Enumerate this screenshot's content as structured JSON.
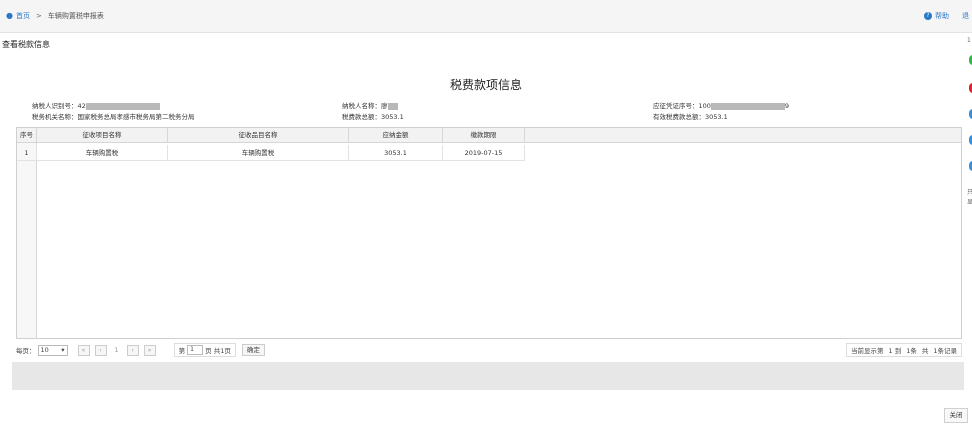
{
  "breadcrumb": {
    "home": "首页",
    "separator": ">",
    "current": "车辆购置税申报表"
  },
  "header": {
    "help_label": "帮助",
    "edge_glyph": "退"
  },
  "right_strip": {
    "chars": [
      "1",
      "只",
      "显"
    ],
    "colors": [
      "#3ab54a",
      "#d9262a",
      "#3b8fd9",
      "#3b8fd9",
      "#3b8fd9"
    ]
  },
  "subheader": "查看税款信息",
  "panel": {
    "title": "税费款项信息",
    "fields": {
      "taxpayer_id_label": "纳税人识别号：",
      "taxpayer_id_visible": "42",
      "taxpayer_name_label": "纳税人名称：",
      "taxpayer_name_visible": "廖",
      "voucher_no_label": "应征凭证序号：",
      "voucher_no_prefix": "100",
      "voucher_no_suffix": "9",
      "tax_office_label": "税务机关名称：",
      "tax_office": "国家税务总局孝感市税务局第二税务分局",
      "tax_total_label": "税费款总额：",
      "tax_total": "3053.1",
      "valid_total_label": "有效税费款总额：",
      "valid_total": "3053.1"
    }
  },
  "table": {
    "columns": [
      "序号",
      "征收项目名称",
      "征收品目名称",
      "应纳金额",
      "缴款期限"
    ],
    "rows": [
      {
        "no": "1",
        "item": "车辆购置税",
        "subitem": "车辆购置税",
        "amount": "3053.1",
        "deadline": "2019-07-15"
      }
    ]
  },
  "pager": {
    "per_page_label": "每页：",
    "per_page_value": "10",
    "first": "«",
    "prev": "‹",
    "current_page": "1",
    "next": "›",
    "last": "»",
    "page_prefix": "第",
    "page_input": "1",
    "page_suffix": "页 共1页",
    "confirm": "确定",
    "range_label": "当前显示第",
    "range_from": "1 到",
    "range_to": "1条",
    "total": "共",
    "total_records": "1条记录"
  },
  "close_button": "关闭"
}
